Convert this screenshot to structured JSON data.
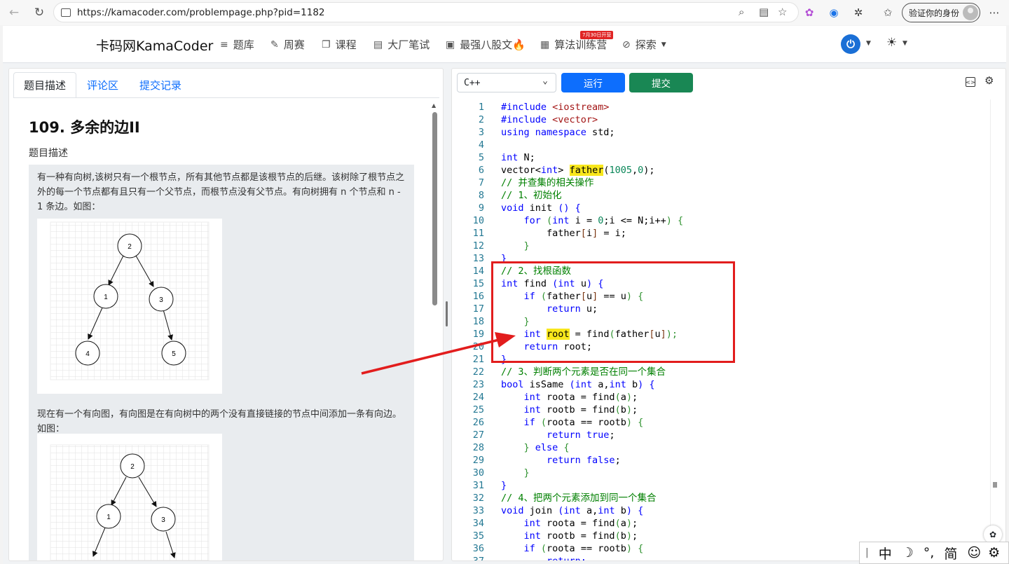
{
  "browser": {
    "url": "https://kamacoder.com/problempage.php?pid=1182",
    "profile_label": "验证你的身份"
  },
  "site": {
    "brand": "卡码网KamaCoder",
    "nav": [
      {
        "icon": "list-icon",
        "label": "题库"
      },
      {
        "icon": "pencil-icon",
        "label": "周赛"
      },
      {
        "icon": "copy-icon",
        "label": "课程"
      },
      {
        "icon": "document-icon",
        "label": "大厂笔试"
      },
      {
        "icon": "book-icon",
        "label": "最强八股文🔥"
      },
      {
        "icon": "calendar-icon",
        "label": "算法训练营"
      },
      {
        "icon": "compass-icon",
        "label": "探索"
      }
    ],
    "camp_badge": "7月30日开营"
  },
  "problem": {
    "tabs": [
      "题目描述",
      "评论区",
      "提交记录"
    ],
    "title": "109. 多余的边II",
    "section_heading": "题目描述",
    "paragraph1": "有一种有向树,该树只有一个根节点，所有其他节点都是该根节点的后继。该树除了根节点之外的每一个节点都有且只有一个父节点，而根节点没有父节点。有向树拥有 n 个节点和 n - 1 条边。如图：",
    "paragraph2": "现在有一个有向图，有向图是在有向树中的两个没有直接链接的节点中间添加一条有向边。如图：",
    "tree1_nodes": [
      "2",
      "1",
      "3",
      "4",
      "5"
    ],
    "tree2_nodes": [
      "2",
      "1",
      "3"
    ]
  },
  "editor": {
    "language": "C++",
    "run_label": "运行",
    "submit_label": "提交"
  },
  "colors": {
    "run": "#0d6efd",
    "submit": "#198754",
    "highlight": "#f8e71c",
    "annotation": "#e21d1d"
  },
  "code_lines": [
    [
      {
        "t": "#include ",
        "c": "k"
      },
      {
        "t": "<iostream>",
        "c": "s"
      }
    ],
    [
      {
        "t": "#include ",
        "c": "k"
      },
      {
        "t": "<vector>",
        "c": "s"
      }
    ],
    [
      {
        "t": "using namespace ",
        "c": "k"
      },
      {
        "t": "std;",
        "c": "p"
      }
    ],
    [],
    [
      {
        "t": "int ",
        "c": "k"
      },
      {
        "t": "N;",
        "c": "p"
      }
    ],
    [
      {
        "t": "vector<",
        "c": "p"
      },
      {
        "t": "int",
        "c": "k"
      },
      {
        "t": "> ",
        "c": "p"
      },
      {
        "t": "father",
        "c": "hl"
      },
      {
        "t": "(",
        "c": "p"
      },
      {
        "t": "1005",
        "c": "n"
      },
      {
        "t": ",",
        "c": "p"
      },
      {
        "t": "0",
        "c": "n"
      },
      {
        "t": ");",
        "c": "p"
      }
    ],
    [
      {
        "t": "// 并查集的相关操作",
        "c": "c"
      }
    ],
    [
      {
        "t": "// 1、初始化",
        "c": "c"
      }
    ],
    [
      {
        "t": "void ",
        "c": "k"
      },
      {
        "t": "init ",
        "c": "p"
      },
      {
        "t": "() {",
        "c": "k"
      }
    ],
    [
      {
        "t": "    for ",
        "c": "k"
      },
      {
        "t": "(",
        "c": "br2"
      },
      {
        "t": "int ",
        "c": "k"
      },
      {
        "t": "i = ",
        "c": "p"
      },
      {
        "t": "0",
        "c": "n"
      },
      {
        "t": ";i <= N;i++",
        "c": "p"
      },
      {
        "t": ") {",
        "c": "br2"
      }
    ],
    [
      {
        "t": "        father",
        "c": "p"
      },
      {
        "t": "[",
        "c": "br3"
      },
      {
        "t": "i",
        "c": "p"
      },
      {
        "t": "]",
        "c": "br3"
      },
      {
        "t": " = i;",
        "c": "p"
      }
    ],
    [
      {
        "t": "    }",
        "c": "br2"
      }
    ],
    [
      {
        "t": "}",
        "c": "k"
      }
    ],
    [
      {
        "t": "// 2、找根函数",
        "c": "c"
      }
    ],
    [
      {
        "t": "int ",
        "c": "k"
      },
      {
        "t": "find ",
        "c": "p"
      },
      {
        "t": "(",
        "c": "k"
      },
      {
        "t": "int ",
        "c": "k"
      },
      {
        "t": "u",
        "c": "p"
      },
      {
        "t": ") {",
        "c": "k"
      }
    ],
    [
      {
        "t": "    if ",
        "c": "k"
      },
      {
        "t": "(",
        "c": "br2"
      },
      {
        "t": "father",
        "c": "p"
      },
      {
        "t": "[",
        "c": "br3"
      },
      {
        "t": "u",
        "c": "p"
      },
      {
        "t": "]",
        "c": "br3"
      },
      {
        "t": " == u",
        "c": "p"
      },
      {
        "t": ") {",
        "c": "br2"
      }
    ],
    [
      {
        "t": "        return ",
        "c": "k"
      },
      {
        "t": "u;",
        "c": "p"
      }
    ],
    [
      {
        "t": "    }",
        "c": "br2"
      }
    ],
    [
      {
        "t": "    int ",
        "c": "k"
      },
      {
        "t": "root",
        "c": "hl"
      },
      {
        "t": " = find",
        "c": "p"
      },
      {
        "t": "(",
        "c": "br2"
      },
      {
        "t": "father",
        "c": "p"
      },
      {
        "t": "[",
        "c": "br3"
      },
      {
        "t": "u",
        "c": "p"
      },
      {
        "t": "]",
        "c": "br3"
      },
      {
        "t": ");",
        "c": "br2"
      }
    ],
    [
      {
        "t": "    return ",
        "c": "k"
      },
      {
        "t": "root;",
        "c": "p"
      }
    ],
    [
      {
        "t": "}",
        "c": "k"
      }
    ],
    [
      {
        "t": "// 3、判断两个元素是否在同一个集合",
        "c": "c"
      }
    ],
    [
      {
        "t": "bool ",
        "c": "k"
      },
      {
        "t": "isSame ",
        "c": "p"
      },
      {
        "t": "(",
        "c": "k"
      },
      {
        "t": "int ",
        "c": "k"
      },
      {
        "t": "a,",
        "c": "p"
      },
      {
        "t": "int ",
        "c": "k"
      },
      {
        "t": "b",
        "c": "p"
      },
      {
        "t": ") {",
        "c": "k"
      }
    ],
    [
      {
        "t": "    int ",
        "c": "k"
      },
      {
        "t": "roota = find",
        "c": "p"
      },
      {
        "t": "(",
        "c": "br2"
      },
      {
        "t": "a",
        "c": "p"
      },
      {
        "t": ")",
        "c": "br2"
      },
      {
        "t": ";",
        "c": "p"
      }
    ],
    [
      {
        "t": "    int ",
        "c": "k"
      },
      {
        "t": "rootb = find",
        "c": "p"
      },
      {
        "t": "(",
        "c": "br2"
      },
      {
        "t": "b",
        "c": "p"
      },
      {
        "t": ")",
        "c": "br2"
      },
      {
        "t": ";",
        "c": "p"
      }
    ],
    [
      {
        "t": "    if ",
        "c": "k"
      },
      {
        "t": "(",
        "c": "br2"
      },
      {
        "t": "roota == rootb",
        "c": "p"
      },
      {
        "t": ") {",
        "c": "br2"
      }
    ],
    [
      {
        "t": "        return ",
        "c": "k"
      },
      {
        "t": "true",
        "c": "k"
      },
      {
        "t": ";",
        "c": "p"
      }
    ],
    [
      {
        "t": "    } ",
        "c": "br2"
      },
      {
        "t": "else ",
        "c": "k"
      },
      {
        "t": "{",
        "c": "br2"
      }
    ],
    [
      {
        "t": "        return ",
        "c": "k"
      },
      {
        "t": "false",
        "c": "k"
      },
      {
        "t": ";",
        "c": "p"
      }
    ],
    [
      {
        "t": "    }",
        "c": "br2"
      }
    ],
    [
      {
        "t": "}",
        "c": "k"
      }
    ],
    [
      {
        "t": "// 4、把两个元素添加到同一个集合",
        "c": "c"
      }
    ],
    [
      {
        "t": "void ",
        "c": "k"
      },
      {
        "t": "join ",
        "c": "p"
      },
      {
        "t": "(",
        "c": "k"
      },
      {
        "t": "int ",
        "c": "k"
      },
      {
        "t": "a,",
        "c": "p"
      },
      {
        "t": "int ",
        "c": "k"
      },
      {
        "t": "b",
        "c": "p"
      },
      {
        "t": ") {",
        "c": "k"
      }
    ],
    [
      {
        "t": "    int ",
        "c": "k"
      },
      {
        "t": "roota = find",
        "c": "p"
      },
      {
        "t": "(",
        "c": "br2"
      },
      {
        "t": "a",
        "c": "p"
      },
      {
        "t": ")",
        "c": "br2"
      },
      {
        "t": ";",
        "c": "p"
      }
    ],
    [
      {
        "t": "    int ",
        "c": "k"
      },
      {
        "t": "rootb = find",
        "c": "p"
      },
      {
        "t": "(",
        "c": "br2"
      },
      {
        "t": "b",
        "c": "p"
      },
      {
        "t": ")",
        "c": "br2"
      },
      {
        "t": ";",
        "c": "p"
      }
    ],
    [
      {
        "t": "    if ",
        "c": "k"
      },
      {
        "t": "(",
        "c": "br2"
      },
      {
        "t": "roota == rootb",
        "c": "p"
      },
      {
        "t": ") {",
        "c": "br2"
      }
    ],
    [
      {
        "t": "        return;",
        "c": "k"
      }
    ]
  ],
  "ime": {
    "items": [
      "中",
      "☽",
      "°,",
      "简",
      "☺",
      "⚙"
    ]
  }
}
